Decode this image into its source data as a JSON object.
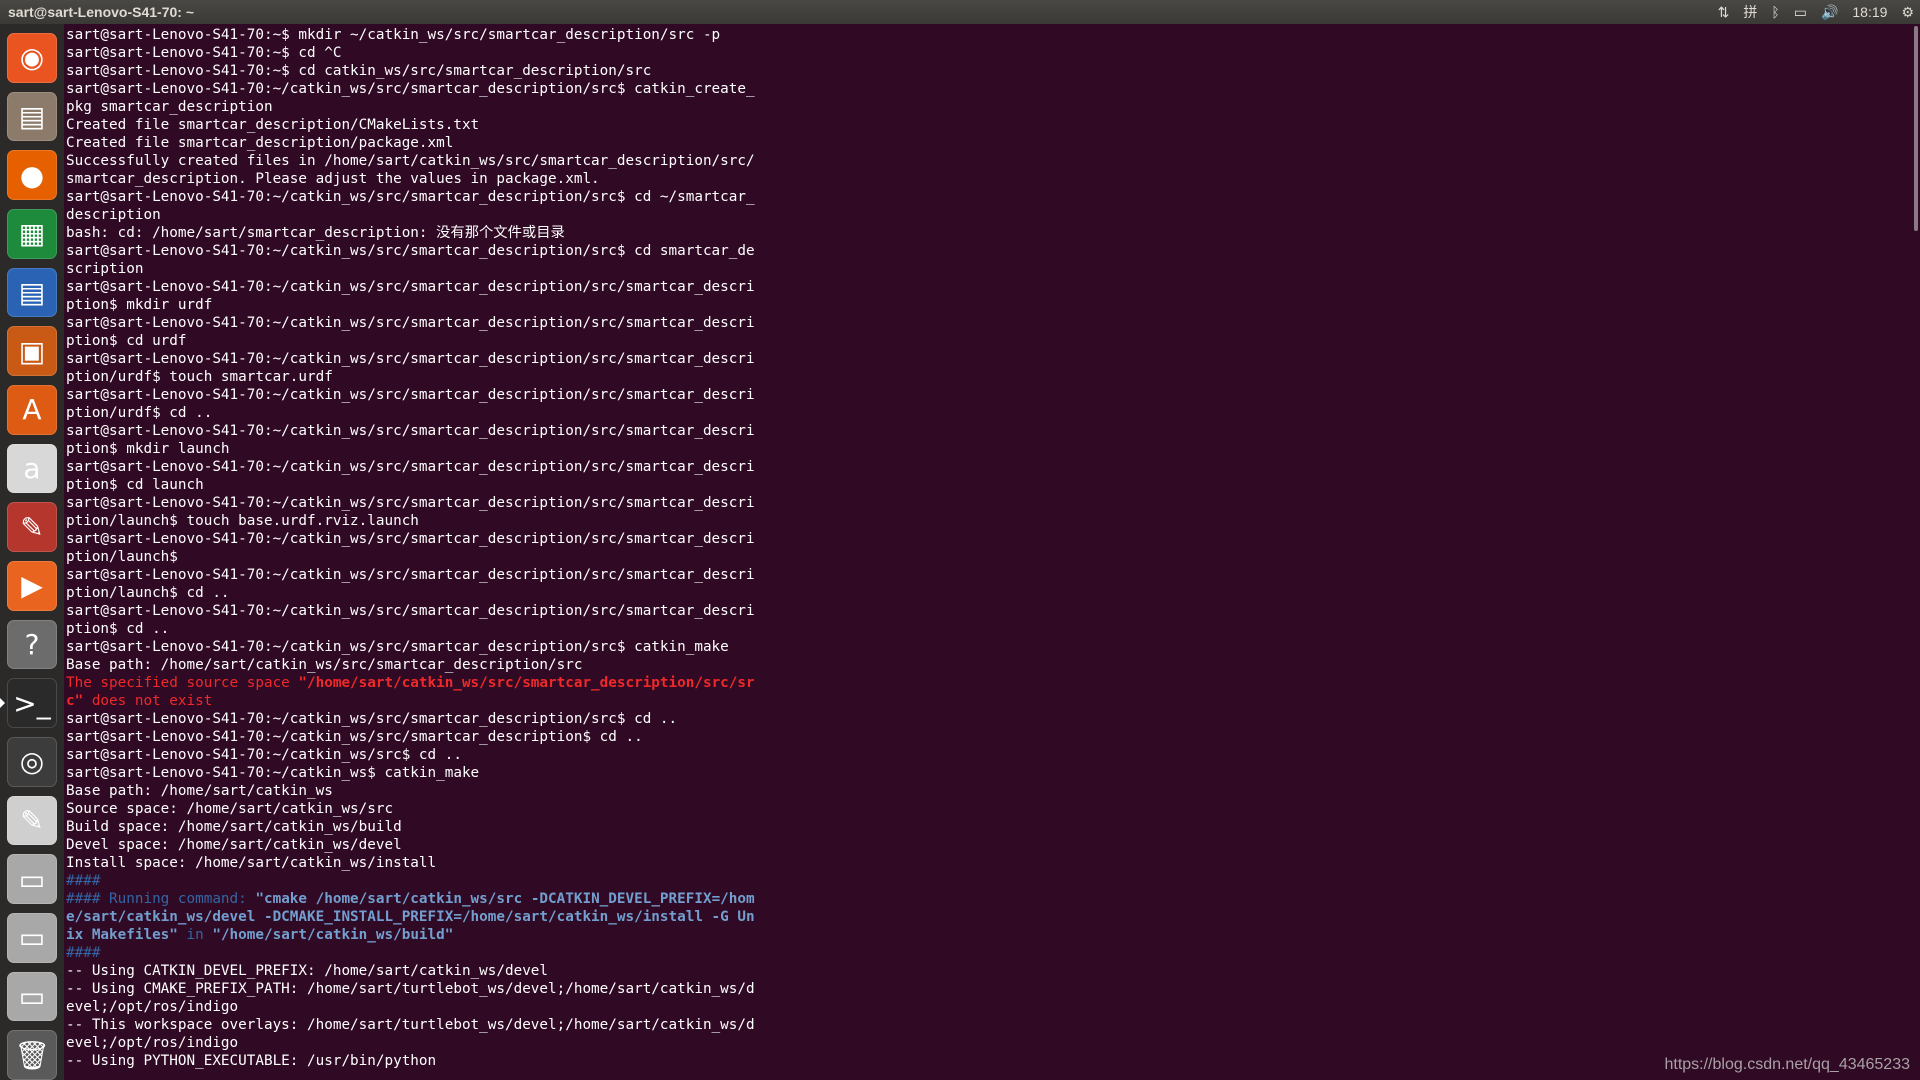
{
  "topbar": {
    "title": "sart@sart-Lenovo-S41-70: ~",
    "tray": {
      "network_icon": "⇅",
      "input_method_icon": "拼",
      "bluetooth_icon": "ᛒ",
      "battery_icon": "▭",
      "volume_icon": "🔊",
      "time": "18:19",
      "settings_icon": "⚙"
    }
  },
  "launcher": [
    {
      "name": "ubuntu-dash-icon",
      "glyph": "◉",
      "bg": "#e95420"
    },
    {
      "name": "files-icon",
      "glyph": "▤",
      "bg": "#8c7b6b"
    },
    {
      "name": "firefox-icon",
      "glyph": "●",
      "bg": "#e66000"
    },
    {
      "name": "libreoffice-calc-icon",
      "glyph": "▦",
      "bg": "#1e8a3c"
    },
    {
      "name": "libreoffice-writer-icon",
      "glyph": "▤",
      "bg": "#2a63b4"
    },
    {
      "name": "libreoffice-impress-icon",
      "glyph": "▣",
      "bg": "#c85a15"
    },
    {
      "name": "software-center-icon",
      "glyph": "A",
      "bg": "#dd5b12"
    },
    {
      "name": "amazon-icon",
      "glyph": "a",
      "bg": "#d8d8d8"
    },
    {
      "name": "system-settings-icon",
      "glyph": "✎",
      "bg": "#b5362d"
    },
    {
      "name": "ubuntu-make-icon",
      "glyph": "▶",
      "bg": "#e9641f"
    },
    {
      "name": "help-icon",
      "glyph": "?",
      "bg": "#6c6c6c"
    },
    {
      "name": "terminal-icon",
      "glyph": ">_",
      "bg": "#2a2a2a",
      "active": true
    },
    {
      "name": "eye-app-icon",
      "glyph": "◎",
      "bg": "#3c3c3c"
    },
    {
      "name": "text-editor-icon",
      "glyph": "✎",
      "bg": "#cfcfcf"
    },
    {
      "name": "disk-drive-icon-1",
      "glyph": "▭",
      "bg": "#a8a8a8"
    },
    {
      "name": "disk-drive-icon-2",
      "glyph": "▭",
      "bg": "#a8a8a8"
    },
    {
      "name": "disk-drive-icon-3",
      "glyph": "▭",
      "bg": "#a8a8a8"
    },
    {
      "name": "trash-icon",
      "glyph": "🗑",
      "bg": "#5a5a5a"
    }
  ],
  "terminal": {
    "lines": [
      [
        {
          "t": "sart@sart-Lenovo-S41-70:~$ mkdir ~/catkin_ws/src/smartcar_description/src -p"
        }
      ],
      [
        {
          "t": "sart@sart-Lenovo-S41-70:~$ cd ^C"
        }
      ],
      [
        {
          "t": "sart@sart-Lenovo-S41-70:~$ cd catkin_ws/src/smartcar_description/src"
        }
      ],
      [
        {
          "t": "sart@sart-Lenovo-S41-70:~/catkin_ws/src/smartcar_description/src$ catkin_create_"
        }
      ],
      [
        {
          "t": "pkg smartcar_description"
        }
      ],
      [
        {
          "t": "Created file smartcar_description/CMakeLists.txt"
        }
      ],
      [
        {
          "t": "Created file smartcar_description/package.xml"
        }
      ],
      [
        {
          "t": "Successfully created files in /home/sart/catkin_ws/src/smartcar_description/src/"
        }
      ],
      [
        {
          "t": "smartcar_description. Please adjust the values in package.xml."
        }
      ],
      [
        {
          "t": "sart@sart-Lenovo-S41-70:~/catkin_ws/src/smartcar_description/src$ cd ~/smartcar_"
        }
      ],
      [
        {
          "t": "description"
        }
      ],
      [
        {
          "t": "bash: cd: /home/sart/smartcar_description: 没有那个文件或目录"
        }
      ],
      [
        {
          "t": "sart@sart-Lenovo-S41-70:~/catkin_ws/src/smartcar_description/src$ cd smartcar_de"
        }
      ],
      [
        {
          "t": "scription"
        }
      ],
      [
        {
          "t": "sart@sart-Lenovo-S41-70:~/catkin_ws/src/smartcar_description/src/smartcar_descri"
        }
      ],
      [
        {
          "t": "ption$ mkdir urdf"
        }
      ],
      [
        {
          "t": "sart@sart-Lenovo-S41-70:~/catkin_ws/src/smartcar_description/src/smartcar_descri"
        }
      ],
      [
        {
          "t": "ption$ cd urdf"
        }
      ],
      [
        {
          "t": "sart@sart-Lenovo-S41-70:~/catkin_ws/src/smartcar_description/src/smartcar_descri"
        }
      ],
      [
        {
          "t": "ption/urdf$ touch smartcar.urdf"
        }
      ],
      [
        {
          "t": "sart@sart-Lenovo-S41-70:~/catkin_ws/src/smartcar_description/src/smartcar_descri"
        }
      ],
      [
        {
          "t": "ption/urdf$ cd .."
        }
      ],
      [
        {
          "t": "sart@sart-Lenovo-S41-70:~/catkin_ws/src/smartcar_description/src/smartcar_descri"
        }
      ],
      [
        {
          "t": "ption$ mkdir launch"
        }
      ],
      [
        {
          "t": "sart@sart-Lenovo-S41-70:~/catkin_ws/src/smartcar_description/src/smartcar_descri"
        }
      ],
      [
        {
          "t": "ption$ cd launch"
        }
      ],
      [
        {
          "t": "sart@sart-Lenovo-S41-70:~/catkin_ws/src/smartcar_description/src/smartcar_descri"
        }
      ],
      [
        {
          "t": "ption/launch$ touch base.urdf.rviz.launch"
        }
      ],
      [
        {
          "t": "sart@sart-Lenovo-S41-70:~/catkin_ws/src/smartcar_description/src/smartcar_descri"
        }
      ],
      [
        {
          "t": "ption/launch$"
        }
      ],
      [
        {
          "t": "sart@sart-Lenovo-S41-70:~/catkin_ws/src/smartcar_description/src/smartcar_descri"
        }
      ],
      [
        {
          "t": "ption/launch$ cd .."
        }
      ],
      [
        {
          "t": "sart@sart-Lenovo-S41-70:~/catkin_ws/src/smartcar_description/src/smartcar_descri"
        }
      ],
      [
        {
          "t": "ption$ cd .."
        }
      ],
      [
        {
          "t": "sart@sart-Lenovo-S41-70:~/catkin_ws/src/smartcar_description/src$ catkin_make"
        }
      ],
      [
        {
          "t": "Base path: /home/sart/catkin_ws/src/smartcar_description/src"
        }
      ],
      [
        {
          "t": "The specified source space ",
          "c": "red"
        },
        {
          "t": "\"/home/sart/catkin_ws/src/smartcar_description/src/sr",
          "c": "redb"
        }
      ],
      [
        {
          "t": "c\"",
          "c": "redb"
        },
        {
          "t": " does not exist",
          "c": "red"
        }
      ],
      [
        {
          "t": "sart@sart-Lenovo-S41-70:~/catkin_ws/src/smartcar_description/src$ cd .."
        }
      ],
      [
        {
          "t": "sart@sart-Lenovo-S41-70:~/catkin_ws/src/smartcar_description$ cd .."
        }
      ],
      [
        {
          "t": "sart@sart-Lenovo-S41-70:~/catkin_ws/src$ cd .."
        }
      ],
      [
        {
          "t": "sart@sart-Lenovo-S41-70:~/catkin_ws$ catkin_make"
        }
      ],
      [
        {
          "t": "Base path: /home/sart/catkin_ws"
        }
      ],
      [
        {
          "t": "Source space: /home/sart/catkin_ws/src"
        }
      ],
      [
        {
          "t": "Build space: /home/sart/catkin_ws/build"
        }
      ],
      [
        {
          "t": "Devel space: /home/sart/catkin_ws/devel"
        }
      ],
      [
        {
          "t": "Install space: /home/sart/catkin_ws/install"
        }
      ],
      [
        {
          "t": "####",
          "c": "blue"
        }
      ],
      [
        {
          "t": "#### Running command: ",
          "c": "blue"
        },
        {
          "t": "\"cmake /home/sart/catkin_ws/src -DCATKIN_DEVEL_PREFIX=/hom",
          "c": "blueb"
        }
      ],
      [
        {
          "t": "e/sart/catkin_ws/devel -DCMAKE_INSTALL_PREFIX=/home/sart/catkin_ws/install -G Un",
          "c": "blueb"
        }
      ],
      [
        {
          "t": "ix Makefiles\"",
          "c": "blueb"
        },
        {
          "t": " in ",
          "c": "blue"
        },
        {
          "t": "\"/home/sart/catkin_ws/build\"",
          "c": "blueb"
        }
      ],
      [
        {
          "t": "####",
          "c": "blue"
        }
      ],
      [
        {
          "t": "-- Using CATKIN_DEVEL_PREFIX: /home/sart/catkin_ws/devel"
        }
      ],
      [
        {
          "t": "-- Using CMAKE_PREFIX_PATH: /home/sart/turtlebot_ws/devel;/home/sart/catkin_ws/d"
        }
      ],
      [
        {
          "t": "evel;/opt/ros/indigo"
        }
      ],
      [
        {
          "t": "-- This workspace overlays: /home/sart/turtlebot_ws/devel;/home/sart/catkin_ws/d"
        }
      ],
      [
        {
          "t": "evel;/opt/ros/indigo"
        }
      ],
      [
        {
          "t": "-- Using PYTHON_EXECUTABLE: /usr/bin/python"
        }
      ]
    ]
  },
  "watermark": "https://blog.csdn.net/qq_43465233"
}
